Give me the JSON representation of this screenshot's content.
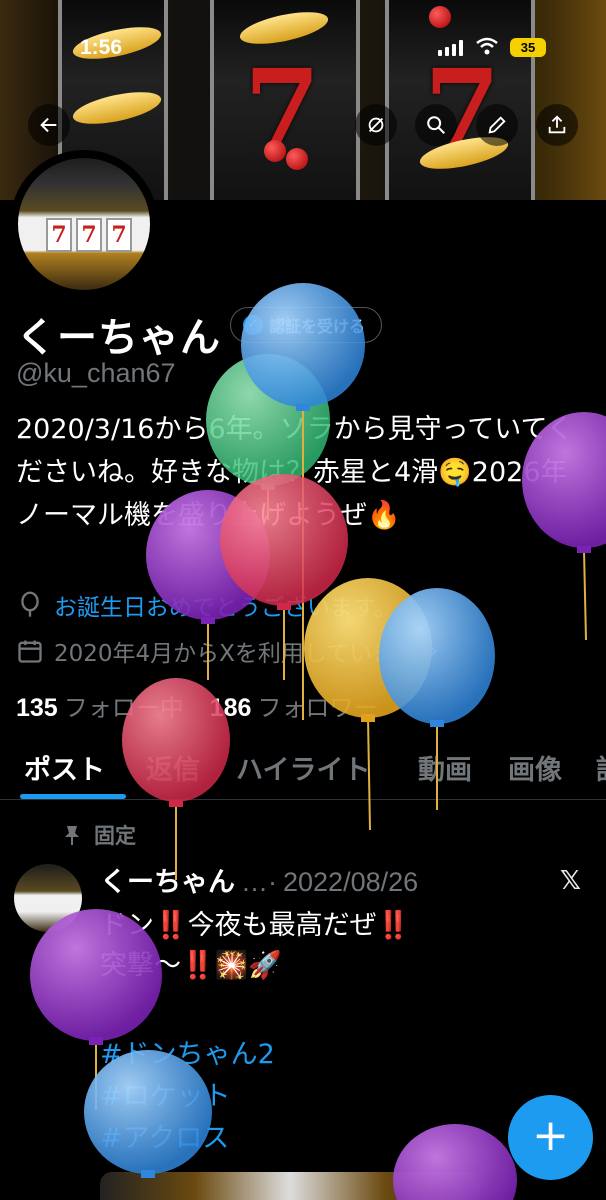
{
  "status_bar": {
    "time": "1:56",
    "battery": "35"
  },
  "banner_buttons": [
    "back-icon",
    "loop-icon",
    "search-icon",
    "edit-icon",
    "share-icon"
  ],
  "profile": {
    "name": "くーちゃん",
    "verify_label": "認証を受ける",
    "handle": "@ku_chan67",
    "bio": "2020/3/16から6年。ソラから見守っていてくださいね。好きな物は？赤星と4滑🤤2026年ノーマル機を盛り上げようぜ🔥",
    "birthday": "お誕生日おめでとうございます。",
    "joined": "2020年4月からXを利用しています",
    "following_count": "135",
    "following_label": "フォロー中",
    "followers_count": "186",
    "followers_label": "フォロワー"
  },
  "tabs": [
    "ポスト",
    "返信",
    "ハイライト",
    "動画",
    "画像",
    "記"
  ],
  "pinned_post": {
    "pinned_label": "固定",
    "author": "くーちゃん",
    "ellipsis": "…·",
    "date": "2022/08/26",
    "text": "ドン‼️今夜も最高だぜ‼️\n突撃〜‼️🎇🚀",
    "hashtags": [
      "#ドンちゃん2",
      "#ロケット",
      "#アクロス"
    ]
  },
  "fab_label": "+",
  "colors": {
    "accent": "#1d9bf0",
    "background": "#000000",
    "muted": "#71767b"
  },
  "balloons": [
    "blue",
    "green",
    "purple",
    "red",
    "yellow",
    "blue",
    "purple",
    "red",
    "purple",
    "blue",
    "purple"
  ]
}
